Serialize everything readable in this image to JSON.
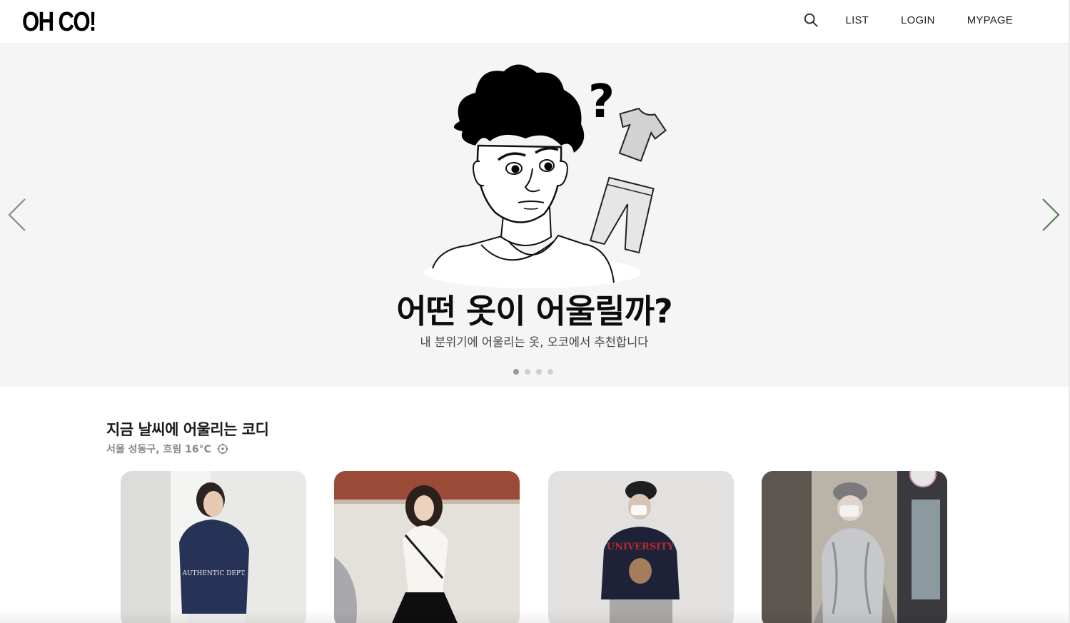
{
  "header": {
    "logo": "OH CO!",
    "nav": [
      "LIST",
      "LOGIN",
      "MYPAGE"
    ]
  },
  "hero": {
    "title": "어떤 옷이 어울릴까?",
    "subtitle": "내 분위기에 어울리는 옷, 오코에서 추천합니다",
    "illustration_symbol": "?",
    "slide_count": 4,
    "active_slide": 1
  },
  "section": {
    "title": "지금 날씨에 어울리는 코디",
    "weather": "서울 성동구, 흐림 16°C"
  },
  "cards": [
    {
      "sweatshirt_text": "AUTHENTIC DEPT."
    },
    {
      "sweatshirt_text": ""
    },
    {
      "sweatshirt_text": "UNIVERSITY"
    },
    {
      "sweatshirt_text": ""
    }
  ],
  "colors": {
    "hero_bg": "#f5f5f5",
    "dot_active": "#999999",
    "dot_inactive": "#cfcfcf"
  },
  "icons": [
    "search-icon",
    "chevron-left-icon",
    "chevron-right-icon",
    "locate-icon"
  ]
}
